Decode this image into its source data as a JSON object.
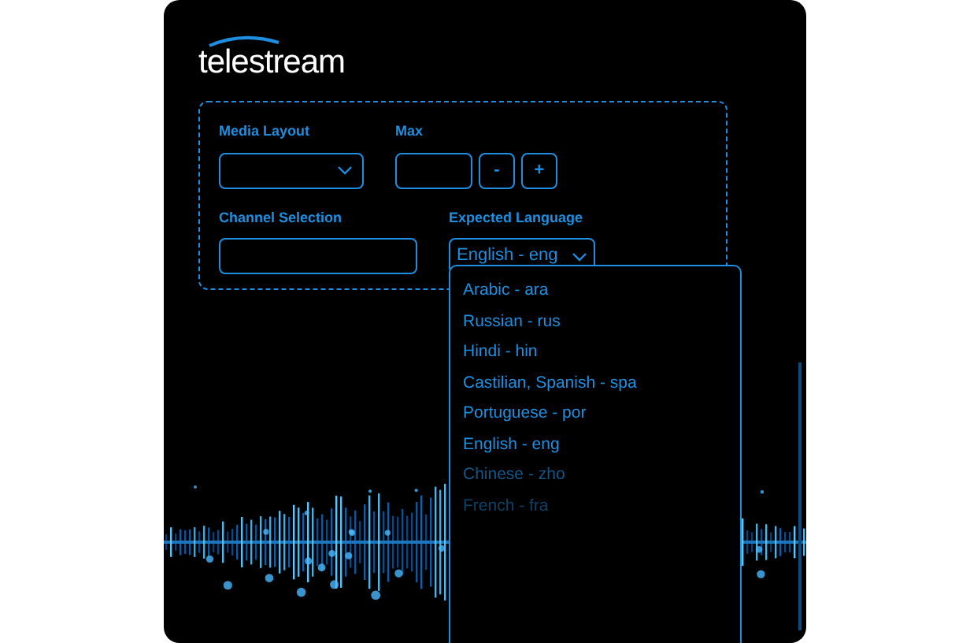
{
  "logo": {
    "text": "telestream"
  },
  "form": {
    "media_layout": {
      "label": "Media Layout"
    },
    "max": {
      "label": "Max",
      "buttons": [
        "-",
        "+"
      ]
    },
    "channel_selection": {
      "label": "Channel Selection"
    },
    "expected_language": {
      "label": "Expected Language",
      "value": "English - eng",
      "expanded": true,
      "options": [
        "Arabic - ara",
        "Russian - rus",
        "Hindi - hin",
        "Castilian, Spanish - spa",
        "Portuguese - por",
        "English - eng",
        "Chinese - zho",
        "French - fra"
      ]
    }
  }
}
